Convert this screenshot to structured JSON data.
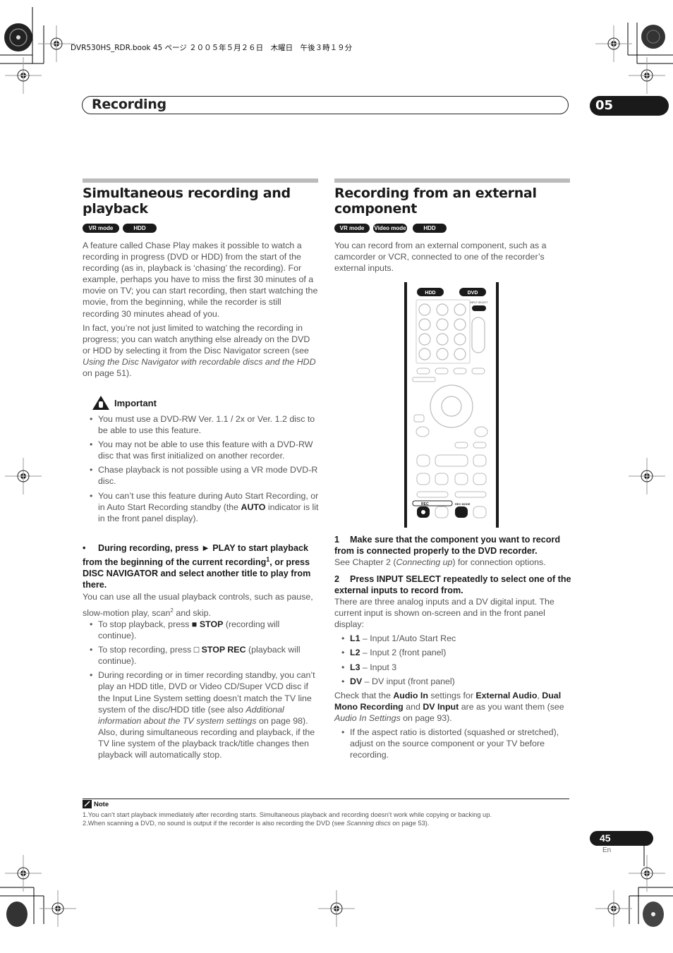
{
  "print_header": "DVR530HS_RDR.book  45 ページ  ２００５年５月２６日　木曜日　午後３時１９分",
  "chapter": {
    "title": "Recording",
    "number": "05"
  },
  "left_section": {
    "title_line1": "Simultaneous recording and",
    "title_line2": "playback",
    "badges": [
      "VR mode",
      "HDD"
    ],
    "para1": "A feature called Chase Play makes it possible to watch a recording in progress (DVD or HDD) from the start of the recording (as in, playback is ‘chasing’ the recording). For example, perhaps you have to miss the first 30 minutes of a movie on TV; you can start recording, then start watching the movie, from the beginning, while the recorder is still recording 30 minutes ahead of you.",
    "para2_a": "In fact, you’re not just limited to watching the recording in progress; you can watch anything else already on the DVD or HDD by selecting it from the Disc Navigator screen (see ",
    "para2_ref": "Using the Disc Navigator with recordable discs and the HDD",
    "para2_b": " on page 51).",
    "important": {
      "heading": "Important",
      "items": [
        "You must use a DVD-RW Ver. 1.1 / 2x or Ver. 1.2 disc to be able to use this feature.",
        "You may not be able to use this feature with a DVD-RW disc that was first initialized on another recorder.",
        "Chase playback is not possible using a VR mode DVD-R disc."
      ],
      "item4_a": "You can’t use this feature during Auto Start Recording, or in Auto Start Recording standby (the ",
      "item4_bold": "AUTO",
      "item4_b": " indicator is lit in the front panel display)."
    },
    "step": {
      "a": "During recording, press ► PLAY to start playback from the beginning of the current recording",
      "sup": "1",
      "b": ", or press DISC NAVIGATOR and select another title to play from there."
    },
    "controls_a": "You can use all the usual playback controls, such as pause, slow-motion play, scan",
    "controls_sup": "2",
    "controls_b": " and skip.",
    "stop_items": [
      {
        "pre": "To stop playback, press ",
        "icon": "■",
        "bold": "STOP",
        "post": " (recording will continue)."
      },
      {
        "pre": "To stop recording, press ",
        "icon": "□",
        "bold": "STOP REC",
        "post": " (playback will continue)."
      }
    ],
    "timer_a": "During recording or in timer recording standby, you can’t play an HDD title, DVD or Video CD/Super VCD disc if the Input Line System setting doesn’t match the TV line system of the disc/HDD title (see also ",
    "timer_ref": "Additional information about the TV system settings",
    "timer_b": " on page 98). Also, during simultaneous recording and playback, if the TV line system of the playback track/title changes then playback will automatically stop."
  },
  "right_section": {
    "title_line1": "Recording from an external",
    "title_line2": "component",
    "badges": [
      "VR mode",
      "Video mode",
      "HDD"
    ],
    "intro": "You can record from an external component, such as a camcorder or VCR, connected to one of the recorder’s external inputs.",
    "remote": {
      "hdd_label": "HDD",
      "dvd_label": "DVD",
      "input_select_label": "INPUT SELECT",
      "rec_label": "REC",
      "rec_mode_label": "REC MODE"
    },
    "step1_num": "1",
    "step1": "Make sure that the component you want to record from is connected properly to the DVD recorder.",
    "step1_note_a": "See Chapter 2 (",
    "step1_note_ref": "Connecting up",
    "step1_note_b": ") for connection options.",
    "step2_num": "2",
    "step2": "Press INPUT SELECT repeatedly to select one of the external inputs to record from.",
    "step2_note": "There are three analog inputs and a DV digital input. The current input is shown on-screen and in the front panel display:",
    "inputs": [
      {
        "code": "L1",
        "desc": " – Input 1/Auto Start Rec"
      },
      {
        "code": "L2",
        "desc": " – Input 2 (front panel)"
      },
      {
        "code": "L3",
        "desc": " – Input 3"
      },
      {
        "code": "DV",
        "desc": " – DV input (front panel)"
      }
    ],
    "check": {
      "a": "Check that the ",
      "b1": "Audio In",
      "c": " settings for ",
      "b2": "External Audio",
      "d": ", ",
      "b3": "Dual Mono Recording",
      "e": " and ",
      "b4": "DV Input",
      "f": " are as you want them (see ",
      "ref": "Audio In Settings",
      "g": " on page 93)."
    },
    "aspect_note": "If the aspect ratio is distorted (squashed or stretched), adjust on the source component or your TV before recording."
  },
  "note": {
    "heading": "Note",
    "line1": "1.You can’t start playback immediately after recording starts. Simultaneous playback and recording doesn’t work while copying or backing up.",
    "line2_a": "2.When scanning a DVD, no sound is output if the recorder is also recording the DVD (see ",
    "line2_ref": "Scanning discs",
    "line2_b": " on page 53)."
  },
  "page": {
    "number": "45",
    "lang": "En"
  }
}
